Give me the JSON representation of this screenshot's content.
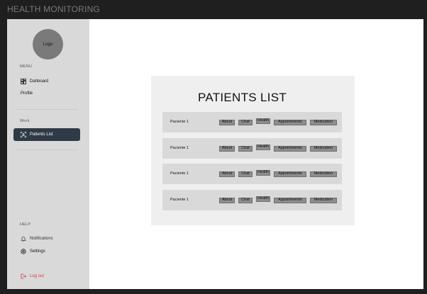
{
  "app": {
    "title": "HEALTH MONITORING"
  },
  "sidebar": {
    "logo": "Logo",
    "menu_label": "MENU",
    "menu_items": [
      {
        "label": "Dahboard",
        "icon": "dashboard-icon"
      },
      {
        "label": "Profile",
        "icon": ""
      }
    ],
    "work_label": "Work",
    "work_items": [
      {
        "label": "Patients List",
        "icon": "patients-icon",
        "active": true
      }
    ],
    "help_label": "HELP",
    "help_items": [
      {
        "label": "Notifications",
        "icon": "bell-icon"
      },
      {
        "label": "Settings",
        "icon": "gear-icon"
      }
    ],
    "logout_label": "Log out"
  },
  "main": {
    "title": "PATIENTS LIST",
    "patients": [
      {
        "name": "Paciente 1"
      },
      {
        "name": "Paciente 1"
      },
      {
        "name": "Paciente 1"
      },
      {
        "name": "Paciente 1"
      }
    ],
    "row_actions": {
      "about": "About",
      "chat": "Chat",
      "health": "Health",
      "appointments": "Appointments",
      "medication": "Medication"
    }
  },
  "colors": {
    "sidebar_bg": "#d9d9d9",
    "active_item_bg": "#2f3a47",
    "logout": "#d8334a",
    "panel_bg": "#efefef",
    "row_bg": "#d9d9d9",
    "tag_bg": "#8e8e8e"
  }
}
